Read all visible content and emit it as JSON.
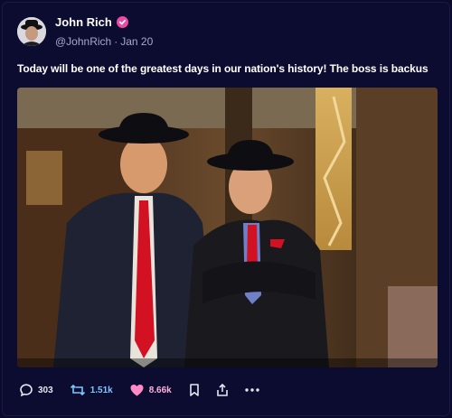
{
  "author": {
    "name": "John Rich",
    "handle": "@JohnRich",
    "separator": "·",
    "date": "Jan 20",
    "verified_color": "#e94ba5"
  },
  "post": {
    "text": "Today will be one of the greatest days in our nation's history! The boss is backus",
    "image_icon": "photo"
  },
  "actions": {
    "reply_count": "303",
    "repost_count": "1.51k",
    "like_count": "8.66k",
    "reply_icon": "comment-bubble-icon",
    "repost_icon": "repost-arrows-icon",
    "like_icon": "heart-icon",
    "bookmark_icon": "bookmark-icon",
    "share_icon": "share-icon",
    "more_icon": "ellipsis-icon"
  },
  "colors": {
    "background": "#0c0b30",
    "repost_accent": "#7ec6ff",
    "like_accent": "#ff8ac6",
    "muted_text": "#a9a8c8"
  }
}
